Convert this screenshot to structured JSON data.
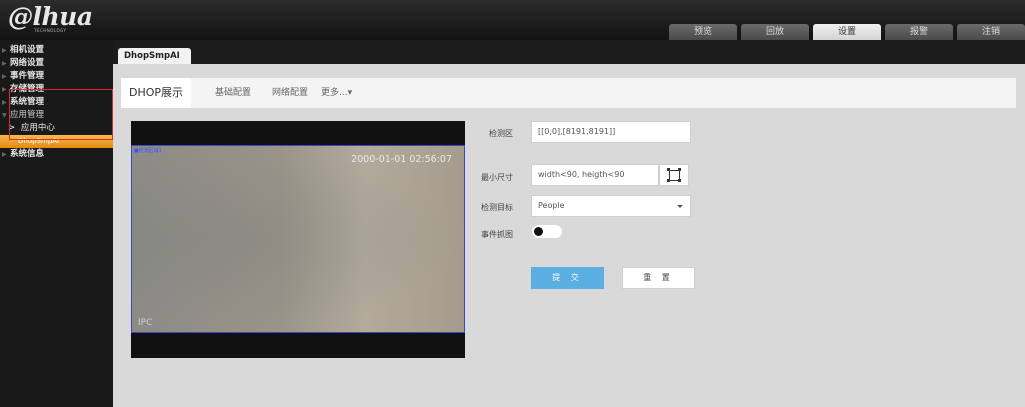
{
  "logo": {
    "brand": "@lhua",
    "tagline": "TECHNOLOGY"
  },
  "topnav": {
    "tabs": [
      {
        "label": "预览",
        "active": false
      },
      {
        "label": "回放",
        "active": false
      },
      {
        "label": "设置",
        "active": true
      },
      {
        "label": "报警",
        "active": false
      },
      {
        "label": "注销",
        "active": false
      }
    ]
  },
  "sidebar": {
    "items": [
      {
        "label": "相机设置"
      },
      {
        "label": "网络设置"
      },
      {
        "label": "事件管理"
      },
      {
        "label": "存储管理"
      },
      {
        "label": "系统管理"
      },
      {
        "label": "应用管理"
      },
      {
        "label": "应用中心"
      },
      {
        "label": "DhopSmpAI"
      },
      {
        "label": "系统信息"
      }
    ]
  },
  "content": {
    "tab_label": "DhopSmpAI",
    "subtabs": {
      "display": "DHOP展示",
      "basic": "基础配置",
      "network": "网络配置",
      "more": "更多...▾"
    },
    "video": {
      "timestamp": "2000-01-01 02:56:07",
      "label": "IPC",
      "region_tag": "■检测区域1"
    },
    "form": {
      "detect_area_label": "检测区",
      "detect_area_value": "[[0,0],[8191,8191]]",
      "min_size_label": "最小尺寸",
      "min_size_value": "width<90, heigth<90",
      "target_label": "检测目标",
      "target_value": "People",
      "snapshot_label": "事件抓图",
      "snapshot_on": false,
      "submit_label": "提 交",
      "reset_label": "重 置"
    }
  },
  "colors": {
    "accent": "#5aaee2",
    "selected": "#f0a030",
    "highlight_box": "#d23030"
  }
}
